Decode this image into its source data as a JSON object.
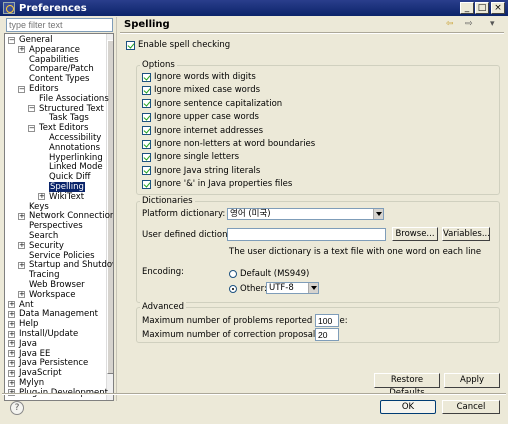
{
  "window": {
    "title": "Preferences",
    "min": "_",
    "max": "□",
    "close": "×"
  },
  "filter": {
    "placeholder": "type filter text"
  },
  "tree": [
    {
      "label": "General",
      "indent": 0,
      "exp": "−"
    },
    {
      "label": "Appearance",
      "indent": 1,
      "exp": "+"
    },
    {
      "label": "Capabilities",
      "indent": 1,
      "exp": ""
    },
    {
      "label": "Compare/Patch",
      "indent": 1,
      "exp": ""
    },
    {
      "label": "Content Types",
      "indent": 1,
      "exp": ""
    },
    {
      "label": "Editors",
      "indent": 1,
      "exp": "−"
    },
    {
      "label": "File Associations",
      "indent": 2,
      "exp": ""
    },
    {
      "label": "Structured Text",
      "indent": 2,
      "exp": "−"
    },
    {
      "label": "Task Tags",
      "indent": 3,
      "exp": ""
    },
    {
      "label": "Text Editors",
      "indent": 2,
      "exp": "−"
    },
    {
      "label": "Accessibility",
      "indent": 3,
      "exp": ""
    },
    {
      "label": "Annotations",
      "indent": 3,
      "exp": ""
    },
    {
      "label": "Hyperlinking",
      "indent": 3,
      "exp": ""
    },
    {
      "label": "Linked Mode",
      "indent": 3,
      "exp": ""
    },
    {
      "label": "Quick Diff",
      "indent": 3,
      "exp": ""
    },
    {
      "label": "Spelling",
      "indent": 3,
      "exp": "",
      "selected": true
    },
    {
      "label": "WikiText",
      "indent": 3,
      "exp": "+"
    },
    {
      "label": "Keys",
      "indent": 1,
      "exp": ""
    },
    {
      "label": "Network Connections",
      "indent": 1,
      "exp": "+"
    },
    {
      "label": "Perspectives",
      "indent": 1,
      "exp": ""
    },
    {
      "label": "Search",
      "indent": 1,
      "exp": ""
    },
    {
      "label": "Security",
      "indent": 1,
      "exp": "+"
    },
    {
      "label": "Service Policies",
      "indent": 1,
      "exp": ""
    },
    {
      "label": "Startup and Shutdown",
      "indent": 1,
      "exp": "+"
    },
    {
      "label": "Tracing",
      "indent": 1,
      "exp": ""
    },
    {
      "label": "Web Browser",
      "indent": 1,
      "exp": ""
    },
    {
      "label": "Workspace",
      "indent": 1,
      "exp": "+"
    },
    {
      "label": "Ant",
      "indent": 0,
      "exp": "+"
    },
    {
      "label": "Data Management",
      "indent": 0,
      "exp": "+"
    },
    {
      "label": "Help",
      "indent": 0,
      "exp": "+"
    },
    {
      "label": "Install/Update",
      "indent": 0,
      "exp": "+"
    },
    {
      "label": "Java",
      "indent": 0,
      "exp": "+"
    },
    {
      "label": "Java EE",
      "indent": 0,
      "exp": "+"
    },
    {
      "label": "Java Persistence",
      "indent": 0,
      "exp": "+"
    },
    {
      "label": "JavaScript",
      "indent": 0,
      "exp": "+"
    },
    {
      "label": "Mylyn",
      "indent": 0,
      "exp": "+"
    },
    {
      "label": "Plug-in Development",
      "indent": 0,
      "exp": "+"
    }
  ],
  "page": {
    "title": "Spelling",
    "nav_back": "⇦",
    "nav_fwd": "⇨",
    "nav_menu": "▾",
    "enable_label": "Enable spell checking",
    "options_title": "Options",
    "options": [
      "Ignore words with digits",
      "Ignore mixed case words",
      "Ignore sentence capitalization",
      "Ignore upper case words",
      "Ignore internet addresses",
      "Ignore non-letters at word boundaries",
      "Ignore single letters",
      "Ignore Java string literals",
      "Ignore '&' in Java properties files"
    ],
    "dict_title": "Dictionaries",
    "platform_label": "Platform dictionary:",
    "platform_value": "영어 (미국)",
    "user_label": "User defined dictionary:",
    "user_value": "",
    "browse": "Browse...",
    "variables": "Variables...",
    "dict_note": "The user dictionary is a text file with one word on each line",
    "encoding_label": "Encoding:",
    "enc_default": "Default (MS949)",
    "enc_other": "Other:",
    "enc_value": "UTF-8",
    "adv_title": "Advanced",
    "max_problems_label": "Maximum number of problems reported per file:",
    "max_problems": "100",
    "max_props_label": "Maximum number of correction proposals:",
    "max_props": "20",
    "restore": "Restore Defaults",
    "apply": "Apply"
  },
  "footer": {
    "help": "?",
    "ok": "OK",
    "cancel": "Cancel"
  }
}
